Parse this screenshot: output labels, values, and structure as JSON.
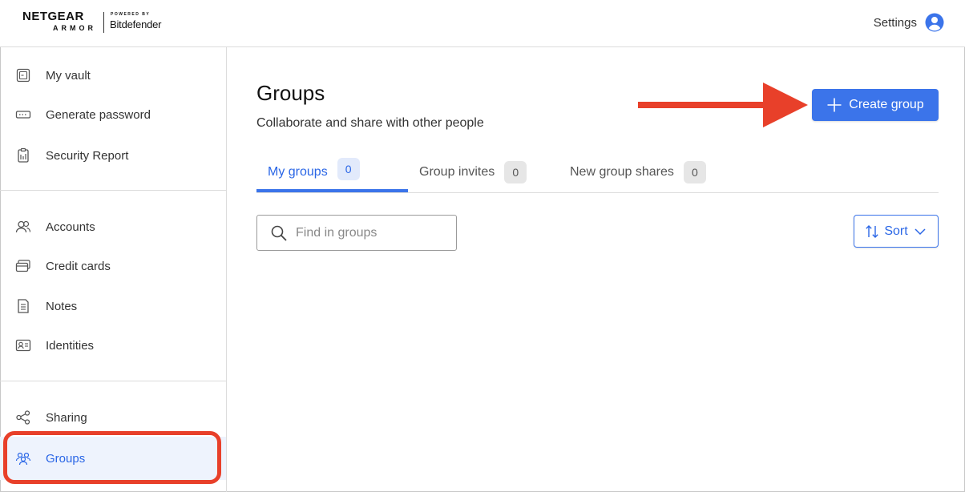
{
  "header": {
    "logo": {
      "brand": "NETGEAR",
      "product": "ARMOR",
      "powered_by": "POWERED BY",
      "partner": "Bitdefender"
    },
    "settings_label": "Settings",
    "settings_icon": "user-circle-icon"
  },
  "sidebar": {
    "sections": [
      [
        {
          "label": "My vault",
          "icon": "vault-icon"
        },
        {
          "label": "Generate password",
          "icon": "password-icon"
        },
        {
          "label": "Security Report",
          "icon": "clipboard-icon"
        }
      ],
      [
        {
          "label": "Accounts",
          "icon": "accounts-icon"
        },
        {
          "label": "Credit cards",
          "icon": "credit-card-icon"
        },
        {
          "label": "Notes",
          "icon": "notes-icon"
        },
        {
          "label": "Identities",
          "icon": "identity-icon"
        }
      ],
      [
        {
          "label": "Sharing",
          "icon": "share-icon"
        },
        {
          "label": "Groups",
          "icon": "groups-icon",
          "active": true
        }
      ]
    ]
  },
  "main": {
    "title": "Groups",
    "subtitle": "Collaborate and share with other people",
    "create_button_label": "Create group",
    "tabs": [
      {
        "label": "My groups",
        "count": "0",
        "active": true
      },
      {
        "label": "Group invites",
        "count": "0"
      },
      {
        "label": "New group shares",
        "count": "0"
      }
    ],
    "search": {
      "placeholder": "Find in groups",
      "value": ""
    },
    "sort_label": "Sort"
  },
  "colors": {
    "accent": "#3b74ea",
    "annotation": "#e8402a",
    "active_bg": "#eef3fd"
  }
}
